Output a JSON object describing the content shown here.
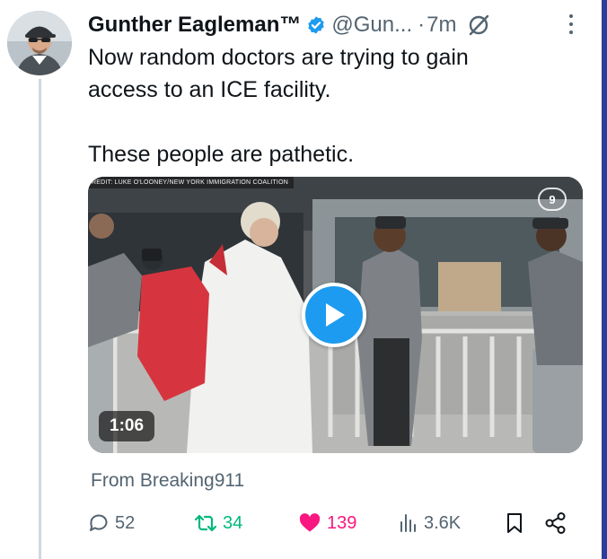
{
  "tweet": {
    "author_name": "Gunther Eagleman™",
    "handle": "@Gun...",
    "separator": "·",
    "time": "7m",
    "text_line1": "Now random doctors are trying to gain",
    "text_line2": "access to an ICE facility.",
    "text_line3": "These people are pathetic.",
    "source": "From Breaking911"
  },
  "media": {
    "credit": "REDIT: LUKE O'LOONEY/NEW YORK IMMIGRATION COALITION",
    "station_logo": "9",
    "duration": "1:06"
  },
  "actions": {
    "replies": "52",
    "reposts": "34",
    "likes": "139",
    "views": "3.6K"
  },
  "icons": [
    "verified-badge-icon",
    "grok-icon",
    "more-icon",
    "play-icon",
    "reply-icon",
    "repost-icon",
    "like-icon",
    "views-icon",
    "bookmark-icon",
    "share-icon"
  ],
  "colors": {
    "verified": "#1d9bf0",
    "repost_active": "#00ba7c",
    "like_active": "#f91880",
    "secondary_text": "#536471"
  }
}
